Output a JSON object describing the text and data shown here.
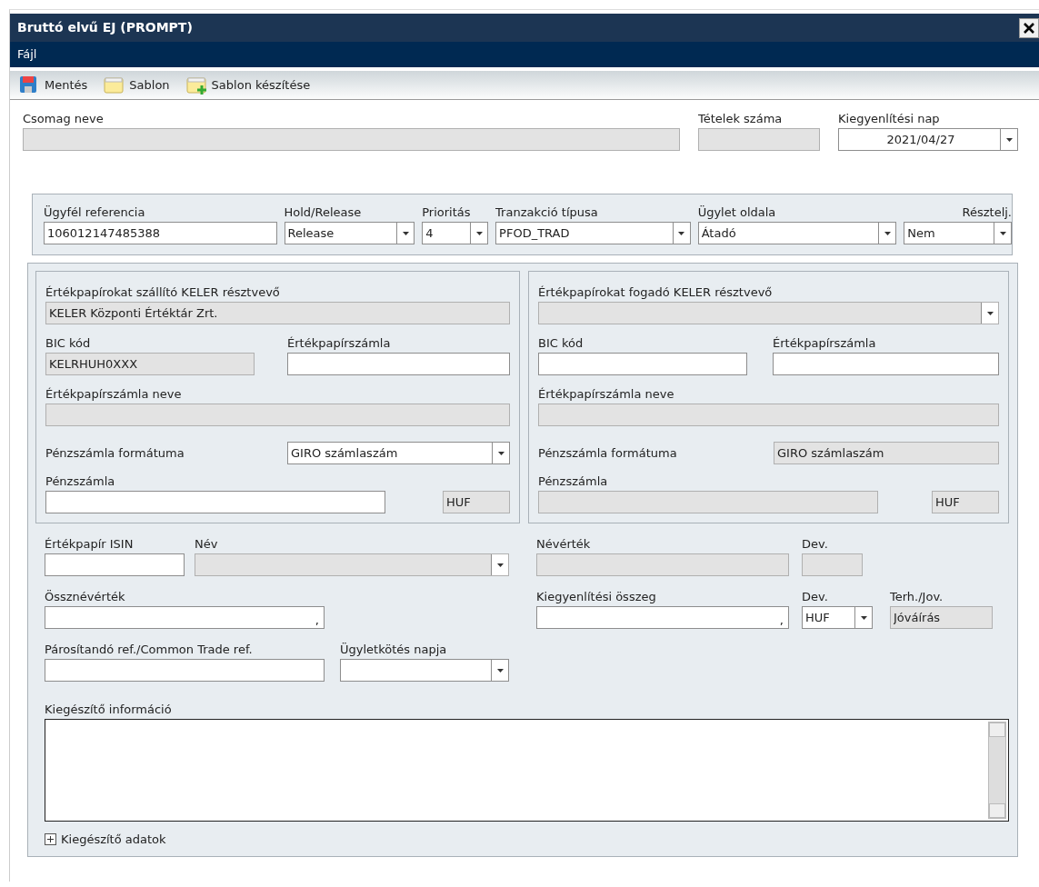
{
  "window": {
    "title": "Bruttó elvű EJ (PROMPT)"
  },
  "menu": [
    {
      "label": "Fájl"
    }
  ],
  "toolbar": [
    {
      "label": "Mentés",
      "kind": "save"
    },
    {
      "label": "Sablon",
      "kind": "template"
    },
    {
      "label": "Sablon készítése",
      "kind": "new_template"
    }
  ],
  "header_fields": [
    {
      "label": "Csomag neve",
      "kind": "readonly"
    },
    {
      "label": "Tételek száma",
      "kind": "readonly"
    },
    {
      "label": "Kiegyenlítési nap",
      "kind": "select",
      "value": "2021/04/27",
      "disabled": false
    }
  ],
  "order_fields": [
    {
      "label": "Ügyfél referencia",
      "kind": "text",
      "value": "106012147485388"
    },
    {
      "label": "Hold/Release",
      "kind": "select",
      "value": "Release",
      "disabled": false
    },
    {
      "label": "Prioritás",
      "kind": "select",
      "value": "4",
      "disabled": false
    },
    {
      "label": "Tranzakció típusa",
      "kind": "select",
      "value": "PFOD_TRAD",
      "disabled": false
    },
    {
      "label": "Ügylet oldala",
      "kind": "select",
      "value": "Átadó",
      "disabled": false
    },
    {
      "label": "Résztelj.",
      "kind": "select",
      "value": "Nem",
      "disabled": false
    }
  ],
  "parties": [
    {
      "participant": {
        "label": "Értékpapírokat szállító KELER résztvevő",
        "kind": "readonly",
        "value": "KELER Központi Értéktár Zrt."
      },
      "bic": {
        "label": "BIC kód",
        "kind": "readonly",
        "value": "KELRHUH0XXX"
      },
      "account": {
        "label": "Értékpapírszámla",
        "kind": "text"
      },
      "account_name": {
        "label": "Értékpapírszámla neve",
        "kind": "readonly"
      },
      "cash_format": {
        "label": "Pénzszámla formátuma",
        "kind": "select",
        "value": "GIRO számlaszám",
        "disabled": false
      },
      "cash_account": {
        "label": "Pénzszámla",
        "kind": "text"
      },
      "currency": {
        "kind": "readonly",
        "value": "HUF"
      }
    },
    {
      "participant": {
        "label": "Értékpapírokat fogadó KELER résztvevő",
        "kind": "select",
        "disabled": true
      },
      "bic": {
        "label": "BIC kód",
        "kind": "text"
      },
      "account": {
        "label": "Értékpapírszámla",
        "kind": "text"
      },
      "account_name": {
        "label": "Értékpapírszámla neve",
        "kind": "readonly"
      },
      "cash_format": {
        "label": "Pénzszámla formátuma",
        "kind": "readonly",
        "value": "GIRO számlaszám"
      },
      "cash_account": {
        "label": "Pénzszámla",
        "kind": "readonly"
      },
      "currency": {
        "kind": "readonly",
        "value": "HUF"
      }
    }
  ],
  "security_rows": [
    [
      {
        "label": "Értékpapír ISIN",
        "kind": "text"
      },
      {
        "label": "Név",
        "kind": "select",
        "disabled": true
      },
      {
        "label": "Névérték",
        "kind": "readonly"
      },
      {
        "label": "Dev.",
        "kind": "readonly"
      }
    ],
    [
      {
        "label": "Össznévérték",
        "kind": "amount",
        "suffix": ","
      },
      {
        "label": "Kiegyenlítési összeg",
        "kind": "amount",
        "suffix": ","
      },
      {
        "label": "Dev.",
        "kind": "select",
        "value": "HUF",
        "disabled": false
      },
      {
        "label": "Terh./Jov.",
        "kind": "readonly",
        "value": "Jóváírás"
      }
    ],
    [
      {
        "label": "Párosítandó ref./Common Trade ref.",
        "kind": "text"
      },
      {
        "label": "Ügyletkötés napja",
        "kind": "select",
        "disabled": false
      }
    ]
  ],
  "additional_info": {
    "label": "Kiegészítő információ",
    "kind": "textarea"
  },
  "expander": {
    "label": "Kiegészítő adatok",
    "expanded": false
  }
}
